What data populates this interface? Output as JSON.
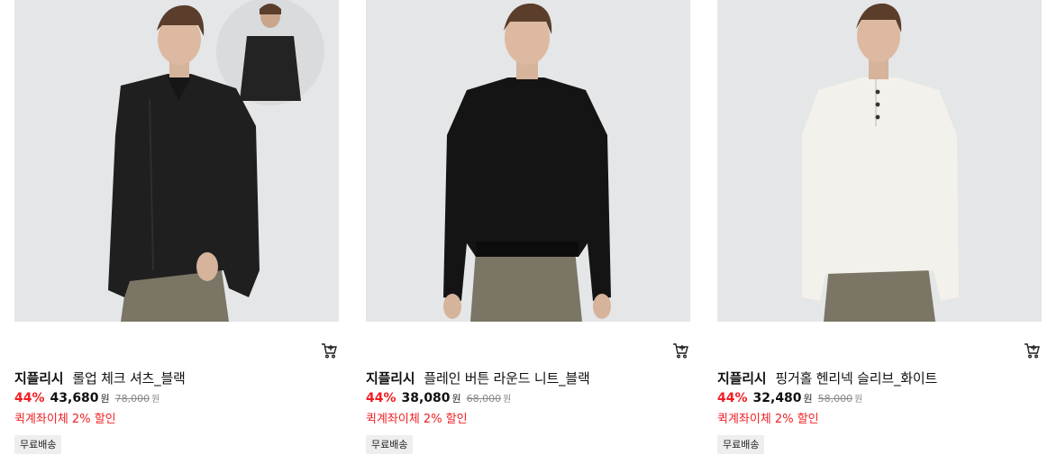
{
  "products": [
    {
      "brand": "지플리시",
      "name": "롤업 체크 셔츠_블랙",
      "discount": "44%",
      "price": "43,680",
      "currency": "원",
      "original_price": "78,000",
      "promo": "퀵계좌이체 2% 할인",
      "badge": "무료배송",
      "cart_icon": "cart-icon",
      "garment_color": "#1f1f1f"
    },
    {
      "brand": "지플리시",
      "name": "플레인 버튼 라운드 니트_블랙",
      "discount": "44%",
      "price": "38,080",
      "currency": "원",
      "original_price": "68,000",
      "promo": "퀵계좌이체 2% 할인",
      "badge": "무료배송",
      "cart_icon": "cart-icon",
      "garment_color": "#141414"
    },
    {
      "brand": "지플리시",
      "name": "핑거홀 헨리넥 슬리브_화이트",
      "discount": "44%",
      "price": "32,480",
      "currency": "원",
      "original_price": "58,000",
      "promo": "퀵계좌이체 2% 할인",
      "badge": "무료배송",
      "cart_icon": "cart-icon",
      "garment_color": "#f3f1ec"
    }
  ],
  "colors": {
    "discount": "#f01e23",
    "image_background": "#e4e6e7",
    "badge_background": "#eeeeee"
  }
}
